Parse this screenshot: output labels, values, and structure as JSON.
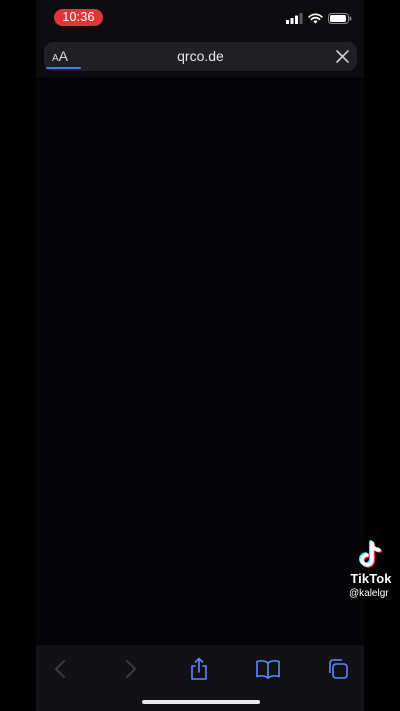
{
  "status_bar": {
    "time": "10:36",
    "recording_color": "#e0363a",
    "icons": [
      "cellular-signal-icon",
      "wifi-icon",
      "battery-icon"
    ]
  },
  "address_bar": {
    "reader_small": "A",
    "reader_big": "A",
    "url": "qrco.de",
    "accent_color": "#3a7bff"
  },
  "toolbar": {
    "buttons": [
      {
        "name": "back",
        "icon": "chevron-left-icon",
        "enabled": false
      },
      {
        "name": "forward",
        "icon": "chevron-right-icon",
        "enabled": false
      },
      {
        "name": "share",
        "icon": "share-icon",
        "enabled": true
      },
      {
        "name": "bookmarks",
        "icon": "book-icon",
        "enabled": true
      },
      {
        "name": "tabs",
        "icon": "tabs-icon",
        "enabled": true
      }
    ]
  },
  "watermark": {
    "brand": "TikTok",
    "handle": "@kalelgr"
  }
}
